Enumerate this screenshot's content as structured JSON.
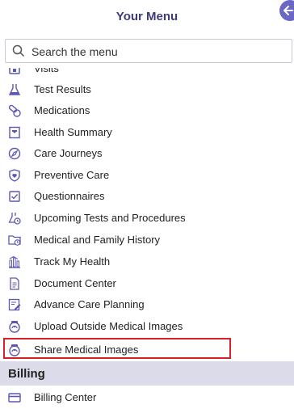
{
  "header": {
    "title": "Your Menu"
  },
  "search": {
    "placeholder": "Search the menu"
  },
  "menu": {
    "items": [
      {
        "label": "Visits",
        "icon": "visits-icon"
      },
      {
        "label": "Test Results",
        "icon": "flask-icon"
      },
      {
        "label": "Medications",
        "icon": "pills-icon"
      },
      {
        "label": "Health Summary",
        "icon": "health-summary-icon"
      },
      {
        "label": "Care Journeys",
        "icon": "compass-icon"
      },
      {
        "label": "Preventive Care",
        "icon": "shield-icon"
      },
      {
        "label": "Questionnaires",
        "icon": "checkbox-icon"
      },
      {
        "label": "Upcoming Tests and Procedures",
        "icon": "flask-clock-icon"
      },
      {
        "label": "Medical and Family History",
        "icon": "folder-clock-icon"
      },
      {
        "label": "Track My Health",
        "icon": "chart-icon"
      },
      {
        "label": "Document Center",
        "icon": "document-icon"
      },
      {
        "label": "Advance Care Planning",
        "icon": "pen-document-icon"
      },
      {
        "label": "Upload Outside Medical Images",
        "icon": "images-icon"
      },
      {
        "label": "Share Medical Images",
        "icon": "images-icon"
      }
    ]
  },
  "billing": {
    "section_label": "Billing",
    "items": [
      {
        "label": "Billing Center",
        "icon": "billing-icon"
      }
    ]
  },
  "colors": {
    "title": "#3e3a7a",
    "icon": "#5b57b5",
    "highlight": "#d8202a",
    "section_bg": "#dcdbe9"
  }
}
